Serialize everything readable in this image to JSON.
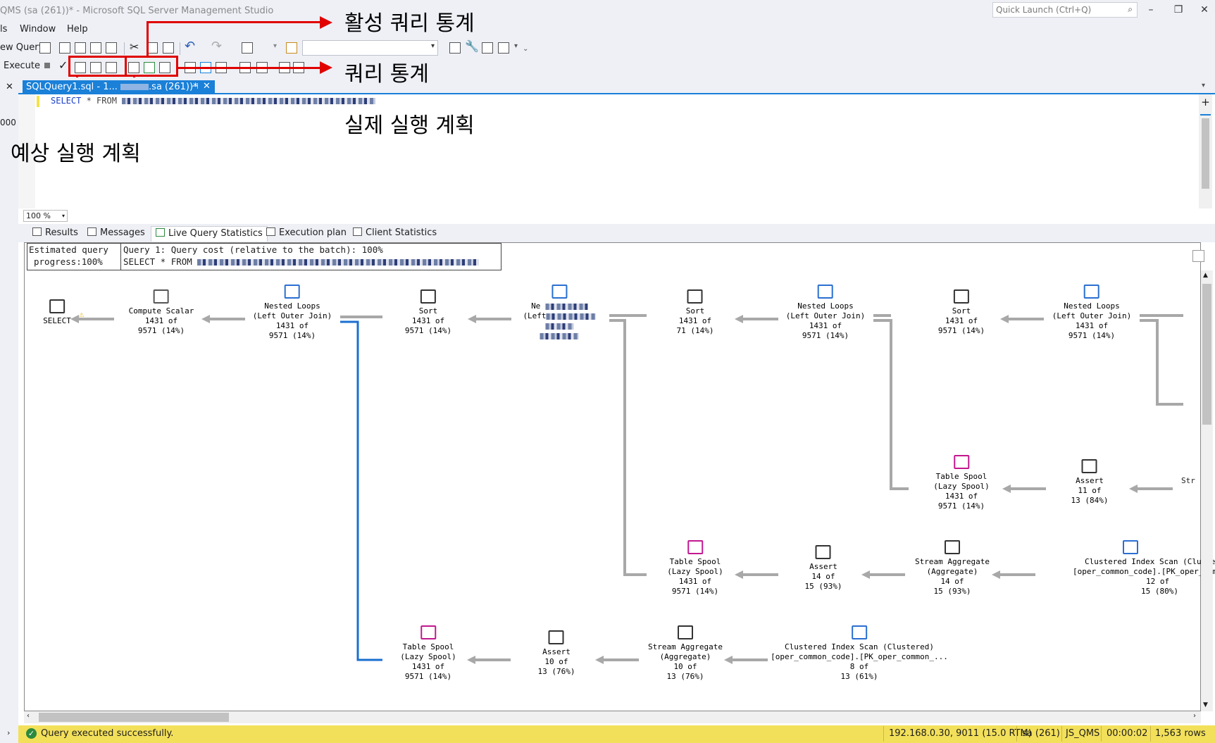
{
  "window": {
    "title": "QMS (sa (261))* - Microsoft SQL Server Management Studio",
    "quick_launch_placeholder": "Quick Launch (Ctrl+Q)"
  },
  "menu": [
    "ls",
    "Window",
    "Help"
  ],
  "toolbar": {
    "new_query": "ew Query",
    "execute": "Execute"
  },
  "annotations": {
    "live_stats": "활성 쿼리 통계",
    "query_stats": "쿼리 통계",
    "actual_plan": "실제 실행 계획",
    "estimated_plan": "예상 실행 계획"
  },
  "doc_tab": {
    "label": "SQLQuery1.sql - 1...",
    "label_tail": ".sa (261))*"
  },
  "left_strip": {
    "value": "000"
  },
  "editor": {
    "keyword": "SELECT",
    "rest": " * FROM"
  },
  "zoom": "100 %",
  "result_tabs": [
    "Results",
    "Messages",
    "Live Query Statistics",
    "Execution plan",
    "Client Statistics"
  ],
  "plan": {
    "progress_line1": "Estimated query",
    "progress_line2": "progress:100%",
    "query_line1": "Query 1: Query cost (relative to the batch): 100%",
    "query_line2": "SELECT * FROM",
    "nodes": [
      {
        "id": "select",
        "lines": [
          "SELECT"
        ]
      },
      {
        "id": "compute",
        "lines": [
          "Compute Scalar",
          "1431 of",
          "9571 (14%)"
        ]
      },
      {
        "id": "nl1",
        "lines": [
          "Nested Loops",
          "(Left Outer Join)",
          "1431 of",
          "9571 (14%)"
        ]
      },
      {
        "id": "sort1",
        "lines": [
          "Sort",
          "1431 of",
          "9571 (14%)"
        ]
      },
      {
        "id": "nl2",
        "lines": [
          "Ne",
          "(Left",
          "",
          ""
        ]
      },
      {
        "id": "sort2",
        "lines": [
          "Sort",
          "1431 of",
          "71 (14%)"
        ]
      },
      {
        "id": "nl3",
        "lines": [
          "Nested Loops",
          "(Left Outer Join)",
          "1431 of",
          "9571 (14%)"
        ]
      },
      {
        "id": "sort3",
        "lines": [
          "Sort",
          "1431 of",
          "9571 (14%)"
        ]
      },
      {
        "id": "nl4",
        "lines": [
          "Nested Loops",
          "(Left Outer Join)",
          "1431 of",
          "9571 (14%)"
        ]
      },
      {
        "id": "spool_r",
        "lines": [
          "Table Spool",
          "(Lazy Spool)",
          "1431 of",
          "9571 (14%)"
        ]
      },
      {
        "id": "assert_r",
        "lines": [
          "Assert",
          "11 of",
          "13 (84%)"
        ]
      },
      {
        "id": "str_r",
        "lines": [
          "Str"
        ]
      },
      {
        "id": "spool_m",
        "lines": [
          "Table Spool",
          "(Lazy Spool)",
          "1431 of",
          "9571 (14%)"
        ]
      },
      {
        "id": "assert_m",
        "lines": [
          "Assert",
          "14 of",
          "15 (93%)"
        ]
      },
      {
        "id": "agg_m",
        "lines": [
          "Stream Aggregate",
          "(Aggregate)",
          "14 of",
          "15 (93%)"
        ]
      },
      {
        "id": "cis_m",
        "lines": [
          "Clustered Index Scan (Clustere",
          "[oper_common_code].[PK_oper_comm",
          "12 of",
          "15 (80%)"
        ]
      },
      {
        "id": "spool_b",
        "lines": [
          "Table Spool",
          "(Lazy Spool)",
          "1431 of",
          "9571 (14%)"
        ]
      },
      {
        "id": "assert_b",
        "lines": [
          "Assert",
          "10 of",
          "13 (76%)"
        ]
      },
      {
        "id": "agg_b",
        "lines": [
          "Stream Aggregate",
          "(Aggregate)",
          "10 of",
          "13 (76%)"
        ]
      },
      {
        "id": "cis_b",
        "lines": [
          "Clustered Index Scan (Clustered)",
          "[oper_common_code].[PK_oper_common_...",
          "8 of",
          "13 (61%)"
        ]
      }
    ]
  },
  "status": {
    "message": "Query executed successfully.",
    "server": "192.168.0.30, 9011 (15.0 RTM)",
    "user": "sa (261)",
    "db": "JS_QMS",
    "time": "00:00:02",
    "rows": "1,563 rows"
  },
  "colors": {
    "accent": "#1a80d8",
    "annotation_red": "#e00000",
    "status_bar": "#f3e05a"
  }
}
